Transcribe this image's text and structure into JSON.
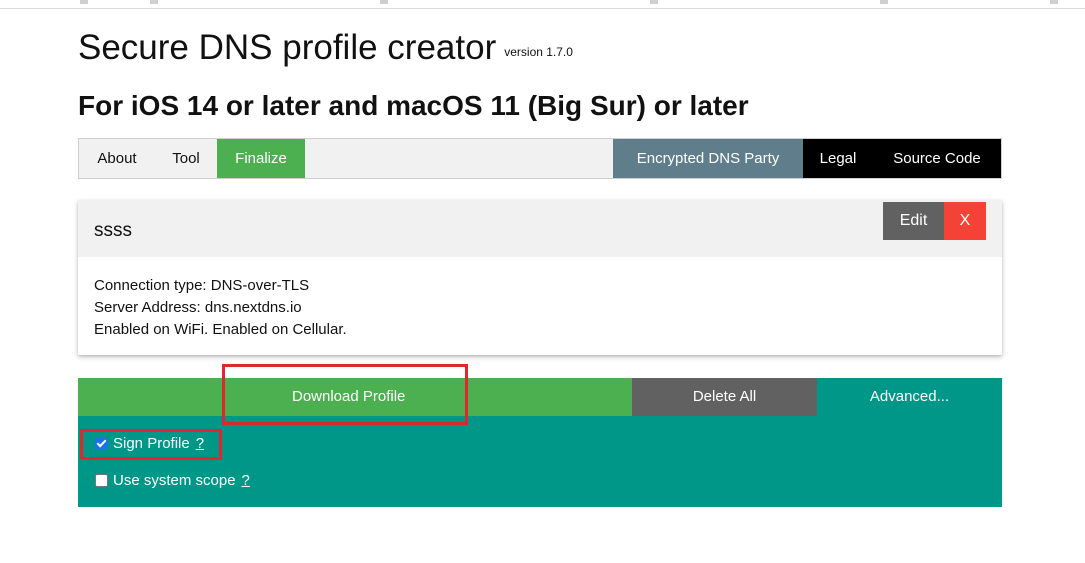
{
  "header": {
    "title": "Secure DNS profile creator",
    "version": "version 1.7.0",
    "subtitle": "For iOS 14 or later and macOS 11 (Big Sur) or later"
  },
  "nav": {
    "about": "About",
    "tool": "Tool",
    "finalize": "Finalize",
    "party": "Encrypted DNS Party",
    "legal": "Legal",
    "source": "Source Code"
  },
  "profile_card": {
    "name": "ssss",
    "edit_label": "Edit",
    "delete_label": "X",
    "connection_type": "Connection type: DNS-over-TLS",
    "server_address": "Server Address: dns.nextdns.io",
    "enabled_on": "Enabled on WiFi. Enabled on Cellular."
  },
  "actions": {
    "download": "Download Profile",
    "delete_all": "Delete All",
    "advanced": "Advanced..."
  },
  "options": {
    "sign_profile": {
      "label": "Sign Profile",
      "help": "?",
      "checked": true
    },
    "system_scope": {
      "label": "Use system scope",
      "help": "?",
      "checked": false
    }
  },
  "colors": {
    "green": "#4caf50",
    "teal": "#009688",
    "gray": "#616161",
    "blue_gray": "#607d8b",
    "red": "#f44336",
    "highlight": "#e3262b"
  }
}
